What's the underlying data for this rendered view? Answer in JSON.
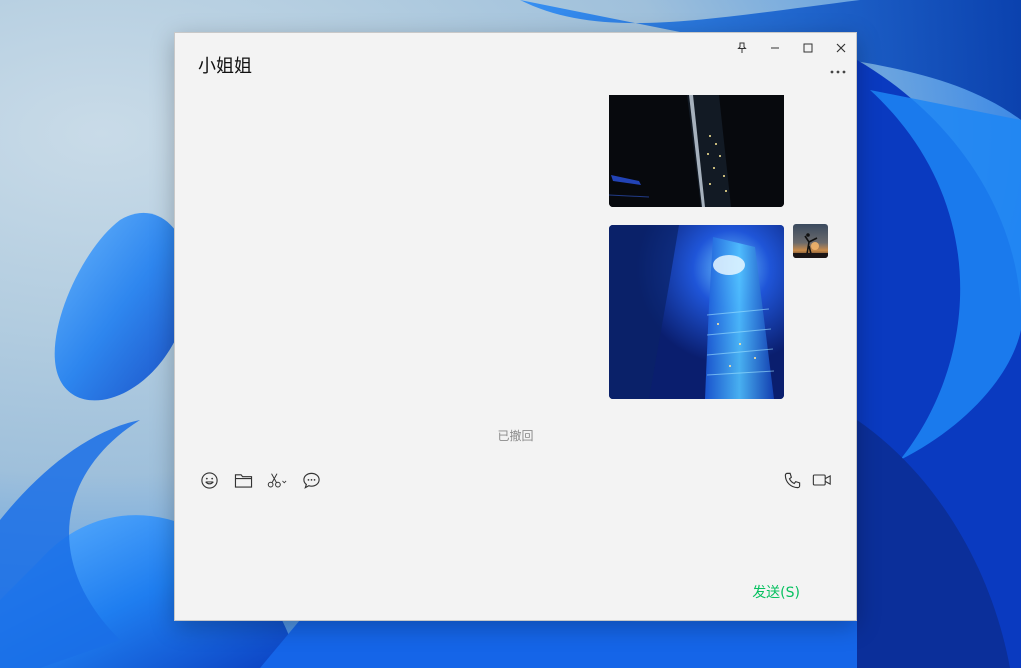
{
  "chat": {
    "title": "小姐姐",
    "recalled_notice": "已撤回"
  },
  "window_controls": {
    "pin": "pin-icon",
    "minimize": "minimize-icon",
    "maximize": "maximize-icon",
    "close": "close-icon"
  },
  "toolbar": {
    "left": [
      "emoji-icon",
      "folder-icon",
      "scissors-icon",
      "chat-bubble-icon"
    ],
    "right": [
      "phone-icon",
      "video-camera-icon"
    ]
  },
  "composer": {
    "send_label": "发送(S)"
  },
  "colors": {
    "accent_send": "#07c160",
    "window_bg": "#f3f3f3"
  }
}
